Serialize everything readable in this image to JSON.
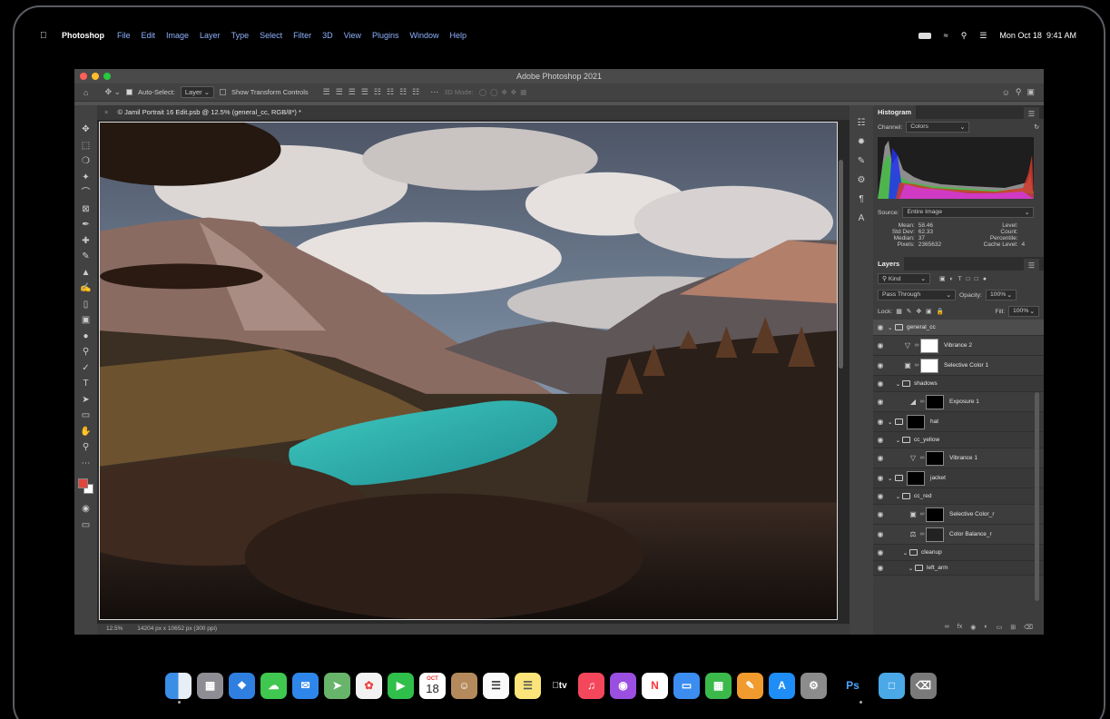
{
  "menubar": {
    "app": "Photoshop",
    "items": [
      "File",
      "Edit",
      "Image",
      "Layer",
      "Type",
      "Select",
      "Filter",
      "3D",
      "View",
      "Plugins",
      "Window",
      "Help"
    ],
    "date": "Mon Oct 18",
    "time": "9:41 AM"
  },
  "window": {
    "title": "Adobe Photoshop 2021"
  },
  "options": {
    "auto_select_label": "Auto-Select:",
    "auto_select_value": "Layer",
    "show_transform_label": "Show Transform Controls",
    "mode_3d": "3D Mode:"
  },
  "document": {
    "tab_title": "© Jamil Portrait 16 Edit.psb @ 12.5% (general_cc, RGB/8*) *",
    "zoom": "12.5%",
    "info": "14204 px x 10652 px (300 ppi)"
  },
  "histogram": {
    "tab": "Histogram",
    "channel_label": "Channel:",
    "channel_value": "Colors",
    "source_label": "Source:",
    "source_value": "Entire Image",
    "stats": {
      "mean_label": "Mean:",
      "mean": "58.46",
      "stddev_label": "Std Dev:",
      "stddev": "62.33",
      "median_label": "Median:",
      "median": "37",
      "pixels_label": "Pixels:",
      "pixels": "2365632",
      "level_label": "Level:",
      "count_label": "Count:",
      "percentile_label": "Percentile:",
      "cache_label": "Cache Level:",
      "cache": "4"
    }
  },
  "layers": {
    "tab": "Layers",
    "filter": "Kind",
    "blend_mode": "Pass Through",
    "opacity_label": "Opacity:",
    "opacity": "100%",
    "lock_label": "Lock:",
    "fill_label": "Fill:",
    "fill": "100%",
    "items": [
      {
        "name": "general_cc"
      },
      {
        "name": "Vibrance 2"
      },
      {
        "name": "Selective Color 1"
      },
      {
        "name": "shadows"
      },
      {
        "name": "Exposure 1"
      },
      {
        "name": "hat"
      },
      {
        "name": "cc_yellow"
      },
      {
        "name": "Vibrance 1"
      },
      {
        "name": "jacket"
      },
      {
        "name": "cc_red"
      },
      {
        "name": "Selective Color_r"
      },
      {
        "name": "Color Balance_r"
      },
      {
        "name": "cleanup"
      },
      {
        "name": "left_arm"
      }
    ]
  },
  "dock": {
    "calendar_month": "OCT",
    "calendar_day": "18",
    "tv_label": "tv",
    "ps_label": "Ps"
  }
}
